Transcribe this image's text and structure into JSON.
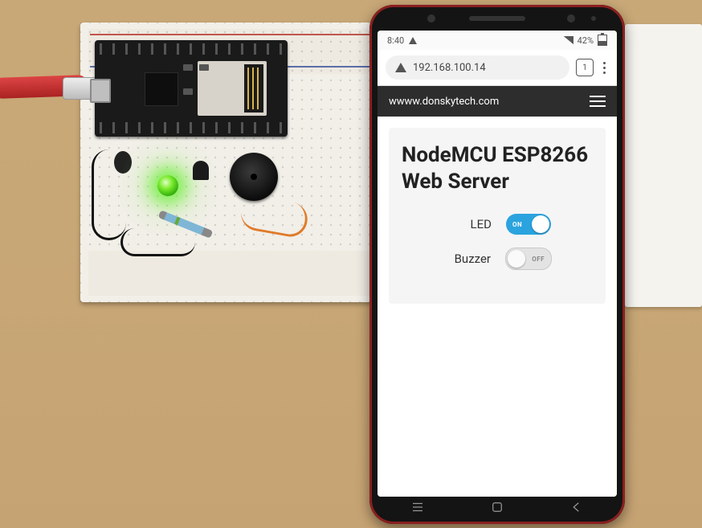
{
  "status_bar": {
    "time": "8:40",
    "signal_label": "signal",
    "battery_pct": "42%"
  },
  "browser": {
    "url": "192.168.100.14",
    "tab_count": "1"
  },
  "site": {
    "title": "wwww.donskytech.com"
  },
  "page": {
    "heading": "NodeMCU ESP8266 Web Server",
    "controls": [
      {
        "label": "LED",
        "state": "on",
        "state_text": "ON"
      },
      {
        "label": "Buzzer",
        "state": "off",
        "state_text": "OFF"
      }
    ]
  },
  "hardware": {
    "board": "NodeMCU ESP8266",
    "led_color": "green",
    "led_on": true,
    "components": [
      "buzzer",
      "resistor",
      "transistor",
      "capacitor",
      "micro-usb-cable"
    ]
  }
}
